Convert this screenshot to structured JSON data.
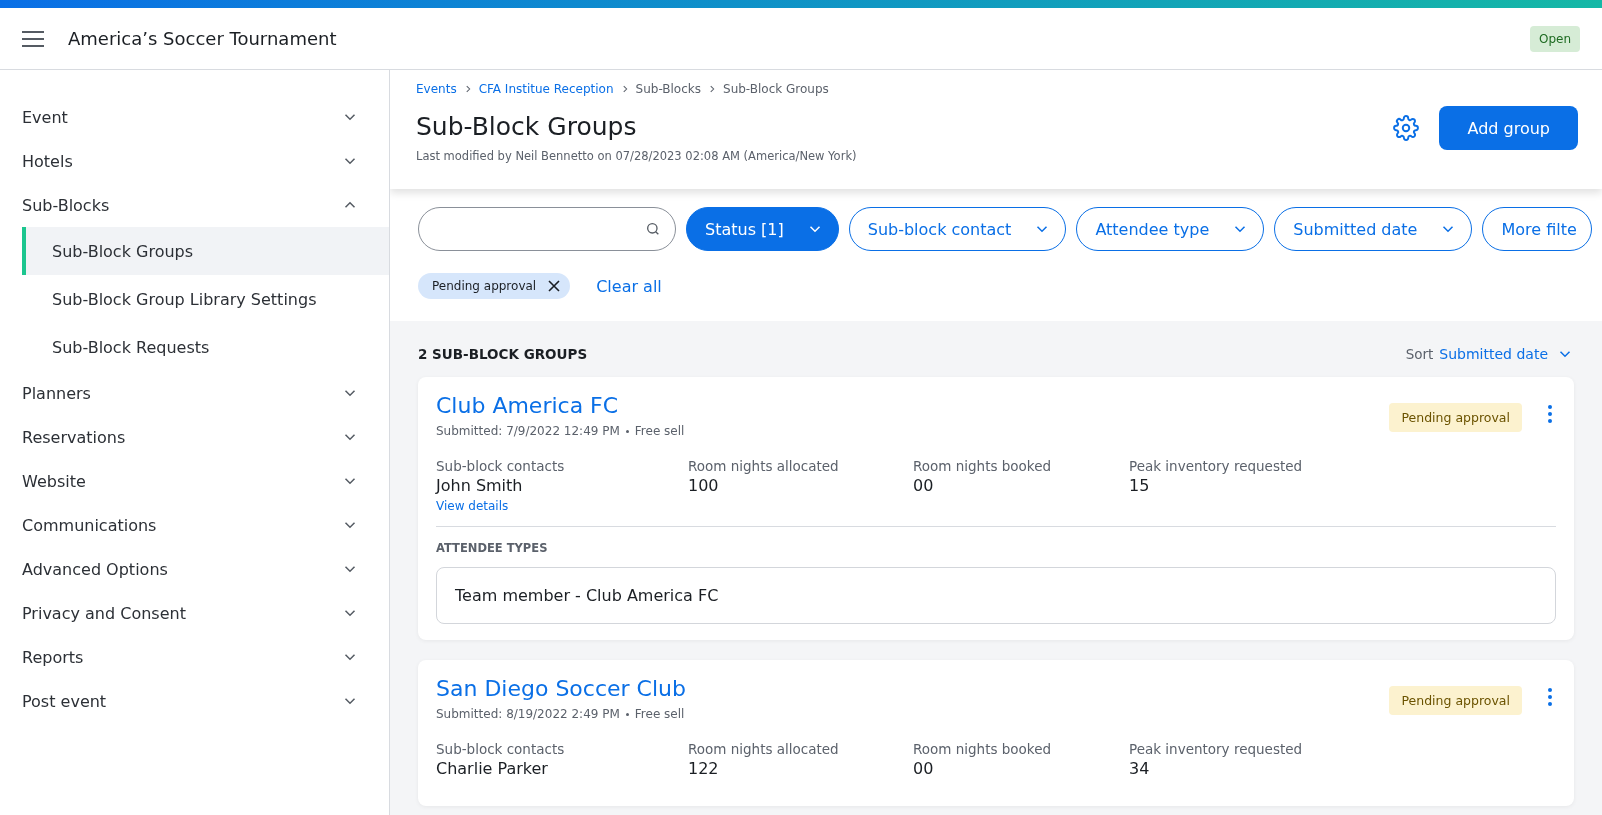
{
  "header": {
    "title": "America’s Soccer Tournament",
    "status": "Open"
  },
  "sidebar": {
    "items": [
      {
        "label": "Event",
        "expanded": false
      },
      {
        "label": "Hotels",
        "expanded": false
      },
      {
        "label": "Sub-Blocks",
        "expanded": true,
        "children": [
          {
            "label": "Sub-Block Groups",
            "selected": true
          },
          {
            "label": "Sub-Block Group Library Settings",
            "selected": false
          },
          {
            "label": "Sub-Block Requests",
            "selected": false
          }
        ]
      },
      {
        "label": "Planners",
        "expanded": false
      },
      {
        "label": "Reservations",
        "expanded": false
      },
      {
        "label": "Website",
        "expanded": false
      },
      {
        "label": "Communications",
        "expanded": false
      },
      {
        "label": "Advanced Options",
        "expanded": false
      },
      {
        "label": "Privacy and Consent",
        "expanded": false
      },
      {
        "label": "Reports",
        "expanded": false
      },
      {
        "label": "Post event",
        "expanded": false
      }
    ]
  },
  "breadcrumbs": [
    {
      "label": "Events",
      "link": true
    },
    {
      "label": "CFA Institue Reception",
      "link": true
    },
    {
      "label": "Sub-Blocks",
      "link": false
    },
    {
      "label": "Sub-Block Groups",
      "link": false
    }
  ],
  "page": {
    "title": "Sub-Block Groups",
    "modified": "Last modified by Neil Bennetto on 07/28/2023 02:08 AM (America/New York)",
    "add_button": "Add group"
  },
  "filters": [
    {
      "label": "Status [1]",
      "selected": true
    },
    {
      "label": "Sub-block contact",
      "selected": false
    },
    {
      "label": "Attendee type",
      "selected": false
    },
    {
      "label": "Submitted date",
      "selected": false
    },
    {
      "label": "More filte",
      "selected": false
    }
  ],
  "active_filters": [
    {
      "label": "Pending approval"
    }
  ],
  "clear_all": "Clear all",
  "list": {
    "count": "2 SUB-BLOCK GROUPS",
    "sort_label": "Sort",
    "sort_value": "Submitted date"
  },
  "groups": [
    {
      "name": "Club America FC",
      "submitted": "Submitted: 7/9/2022 12:49 PM",
      "sell": "Free sell",
      "status": "Pending approval",
      "stats": [
        {
          "label": "Sub-block contacts",
          "value": "John Smith",
          "link": "View details"
        },
        {
          "label": "Room nights allocated",
          "value": "100"
        },
        {
          "label": "Room nights booked",
          "value": "00"
        },
        {
          "label": "Peak inventory requested",
          "value": "15"
        }
      ],
      "attendee_heading": "ATTENDEE TYPES",
      "attendee_types": [
        "Team member - Club America FC"
      ]
    },
    {
      "name": "San Diego Soccer Club",
      "submitted": "Submitted: 8/19/2022 2:49 PM",
      "sell": "Free sell",
      "status": "Pending approval",
      "stats": [
        {
          "label": "Sub-block contacts",
          "value": "Charlie Parker"
        },
        {
          "label": "Room nights allocated",
          "value": "122"
        },
        {
          "label": "Room nights booked",
          "value": "00"
        },
        {
          "label": "Peak inventory requested",
          "value": "34"
        }
      ]
    }
  ]
}
